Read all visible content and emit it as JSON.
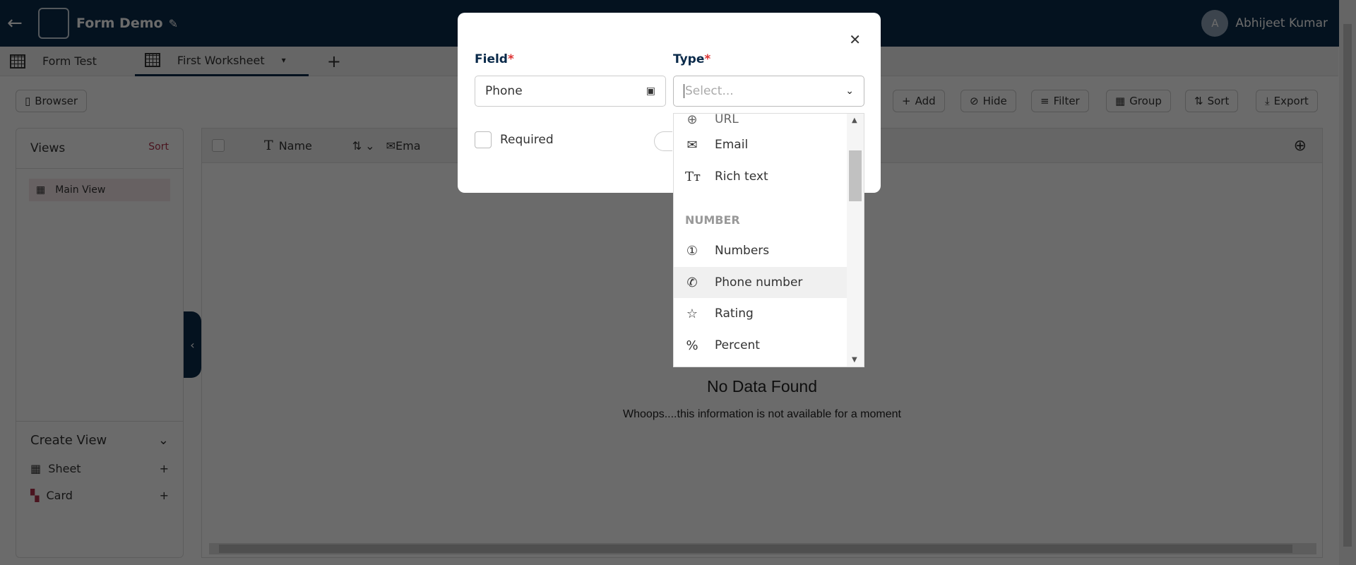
{
  "header": {
    "title": "Form Demo",
    "user_name": "Abhijeet Kumar",
    "avatar_letter": "A"
  },
  "tabs": [
    {
      "label": "Form Test"
    },
    {
      "label": "First Worksheet"
    }
  ],
  "toolbar": {
    "browser": "Browser",
    "add": "Add",
    "hide": "Hide",
    "filter": "Filter",
    "group": "Group",
    "sort": "Sort",
    "export": "Export"
  },
  "views": {
    "title": "Views",
    "sort": "Sort",
    "main_view": "Main View",
    "create_view": "Create View",
    "sheet": "Sheet",
    "card": "Card"
  },
  "grid": {
    "columns": [
      "Name",
      "Ema"
    ],
    "empty_title": "No Data Found",
    "empty_subtitle": "Whoops....this information is not available for a moment"
  },
  "modal": {
    "field_label": "Field",
    "type_label": "Type",
    "required_mark": "*",
    "field_value": "Phone",
    "type_placeholder": "Select...",
    "required_label": "Required"
  },
  "dropdown": {
    "partial": "URL",
    "items": [
      {
        "label": "Email",
        "icon": "mail-icon"
      },
      {
        "label": "Rich text",
        "icon": "rich-text-icon"
      }
    ],
    "group": "NUMBER",
    "number_items": [
      {
        "label": "Numbers",
        "icon": "number-circle-icon"
      },
      {
        "label": "Phone number",
        "icon": "phone-icon"
      },
      {
        "label": "Rating",
        "icon": "star-icon"
      },
      {
        "label": "Percent",
        "icon": "percent-icon"
      }
    ],
    "hovered": "Phone number"
  }
}
